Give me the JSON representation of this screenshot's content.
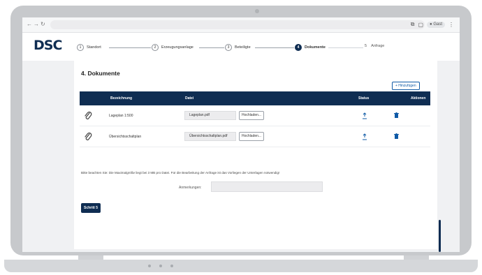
{
  "header": {
    "logo_text": "DSC",
    "steps": [
      {
        "number": "1",
        "label": "Standort"
      },
      {
        "number": "2",
        "label": "Erzeugungsanlage"
      },
      {
        "number": "3",
        "label": "Beteiligte"
      },
      {
        "number": "4",
        "label": "Dokumente"
      },
      {
        "number": "5",
        "label": "Anfrage"
      }
    ],
    "active_step": 4
  },
  "browser": {
    "nav_icons": [
      "back-icon",
      "forward-icon",
      "reload-icon"
    ],
    "profile_label": "Gast"
  },
  "section": {
    "title": "4. Dokumente",
    "add_label": "+ Hinzufügen"
  },
  "table": {
    "headers": [
      "Bezeichnung",
      "Datei",
      "Status",
      "Aktionen"
    ],
    "rows": [
      {
        "label": "Lageplan 1:500",
        "file": "Lageplan.pdf",
        "upload_label": "Hochladen..."
      },
      {
        "label": "Übersichtsschaltplan",
        "file": "Übersichtsschaltplan.pdf",
        "upload_label": "Hochladen..."
      }
    ]
  },
  "notice": "Bitte beachten Sie: Die Maximalgröße liegt bei 3 MB pro Datei. Für die Bearbeitung der Anfrage ist das Vorliegen der Unterlagen notwendig!",
  "remarks": {
    "label": "Anmerkungen:",
    "value": ""
  },
  "next_button": "Schritt 5",
  "colors": {
    "primary": "#0f2d52",
    "accent": "#0f5aa6",
    "input_bg": "#ececee"
  }
}
